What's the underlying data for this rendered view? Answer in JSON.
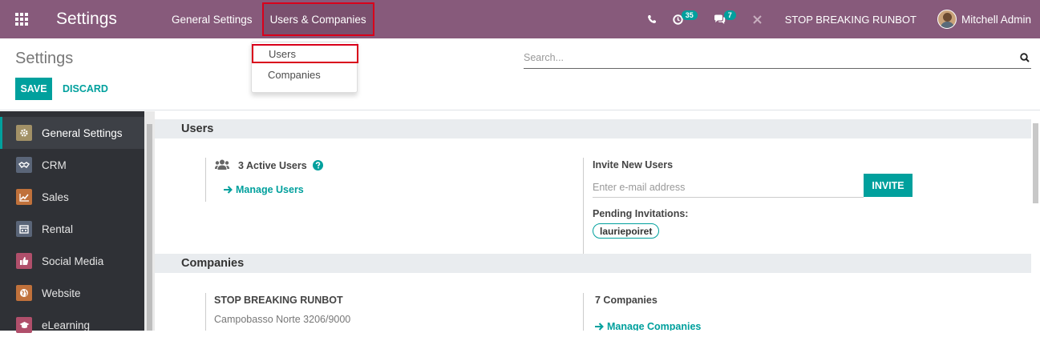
{
  "navbar": {
    "brand": "Settings",
    "menu": [
      "General Settings",
      "Users & Companies"
    ],
    "activity_badge": "35",
    "messages_badge": "7",
    "company": "STOP BREAKING RUNBOT",
    "user": "Mitchell Admin"
  },
  "dropdown": {
    "items": [
      "Users",
      "Companies"
    ]
  },
  "control": {
    "breadcrumb": "Settings",
    "save_label": "SAVE",
    "discard_label": "DISCARD",
    "search_placeholder": "Search..."
  },
  "sidebar": {
    "items": [
      {
        "label": "General Settings",
        "icon": "gear-icon",
        "color": "#a29167"
      },
      {
        "label": "CRM",
        "icon": "handshake-icon",
        "color": "#5a6578"
      },
      {
        "label": "Sales",
        "icon": "chart-icon",
        "color": "#c0713b"
      },
      {
        "label": "Rental",
        "icon": "calendar-icon",
        "color": "#5a6578"
      },
      {
        "label": "Social Media",
        "icon": "thumbs-up-icon",
        "color": "#b04f6b"
      },
      {
        "label": "Website",
        "icon": "globe-icon",
        "color": "#c0713b"
      },
      {
        "label": "eLearning",
        "icon": "graduation-icon",
        "color": "#b04f6b"
      }
    ]
  },
  "users_section": {
    "title": "Users",
    "active_users": "3 Active Users",
    "manage_users": "Manage Users",
    "invite_title": "Invite New Users",
    "invite_placeholder": "Enter e-mail address",
    "invite_button": "INVITE",
    "pending_title": "Pending Invitations:",
    "pending_tag": "lauriepoiret"
  },
  "companies_section": {
    "title": "Companies",
    "company_name": "STOP BREAKING RUNBOT",
    "company_address": "Campobasso Norte 3206/9000",
    "companies_count": "7 Companies",
    "manage_companies": "Manage Companies"
  },
  "colors": {
    "brand": "#875a7b",
    "accent": "#00a09d",
    "highlight": "#d9001b"
  }
}
